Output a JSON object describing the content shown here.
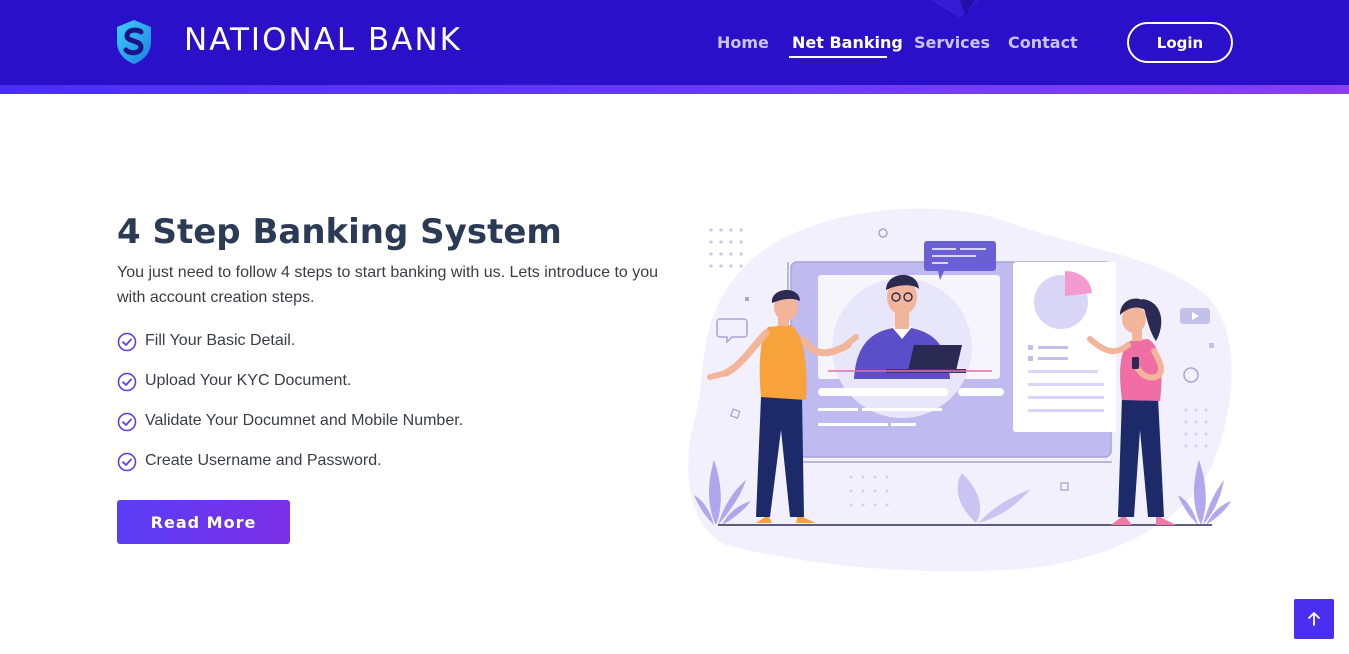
{
  "brand": {
    "name": "NATIONAL BANK",
    "logo_icon": "shield-s-logo",
    "colors": {
      "primary": "#2a10c9",
      "accent": "#5a3df5",
      "heading": "#2b3a55"
    }
  },
  "nav": {
    "items": [
      {
        "label": "Home",
        "active": false
      },
      {
        "label": "Net Banking",
        "active": true
      },
      {
        "label": "Services",
        "active": false
      },
      {
        "label": "Contact",
        "active": false
      }
    ],
    "login_label": "Login"
  },
  "main": {
    "title": "4 Step Banking System",
    "intro": "You just need to follow 4 steps to start banking with us. Lets introduce to you with account creation steps.",
    "steps": [
      "Fill Your Basic Detail.",
      "Upload Your KYC Document.",
      "Validate Your Documnet and Mobile Number.",
      "Create Username and Password."
    ],
    "cta_label": "Read More",
    "illustration": "online-banking-video-call-illustration"
  },
  "scroll_top_icon": "arrow-up-icon"
}
